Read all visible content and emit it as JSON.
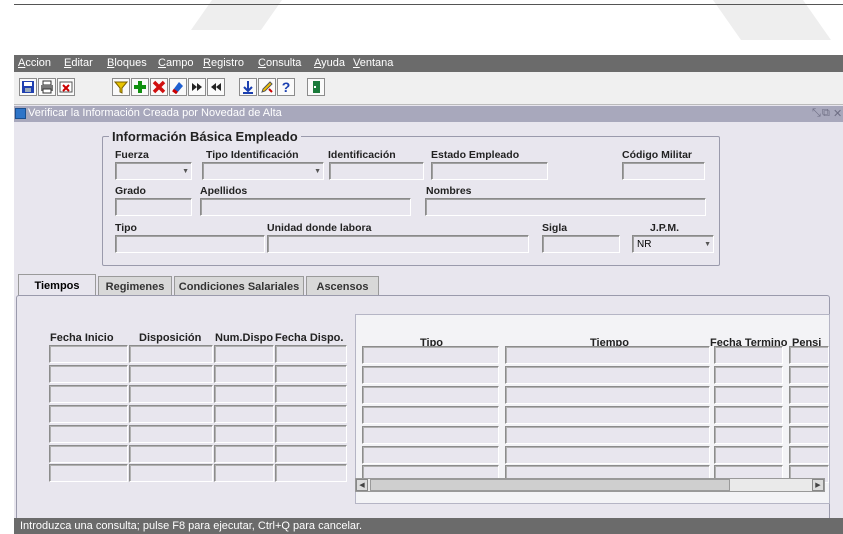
{
  "menu": [
    "Accion",
    "Editar",
    "Bloques",
    "Campo",
    "Registro",
    "Consulta",
    "Ayuda",
    "Ventana"
  ],
  "window": {
    "title": "Verificar la Información Creada por Novedad de Alta"
  },
  "group": {
    "title": "Información Básica Empleado",
    "labels": {
      "fuerza": "Fuerza",
      "tipo_identificacion": "Tipo Identificación",
      "identificacion": "Identificación",
      "estado_empleado": "Estado Empleado",
      "codigo_militar": "Código Militar",
      "grado": "Grado",
      "apellidos": "Apellidos",
      "nombres": "Nombres",
      "tipo": "Tipo",
      "unidad": "Unidad donde labora",
      "sigla": "Sigla",
      "jpm": "J.P.M."
    },
    "jpm_value": "NR"
  },
  "tabs": [
    "Tiempos",
    "Regimenes",
    "Condiciones Salariales",
    "Ascensos"
  ],
  "left_columns": [
    "Fecha Inicio",
    "Disposición",
    "Num.Dispo",
    "Fecha Dispo."
  ],
  "right_columns": [
    "Tipo",
    "Tiempo",
    "Fecha Termino",
    "Pensi"
  ],
  "status": "Introduzca una consulta;  pulse F8 para ejecutar, Ctrl+Q para cancelar."
}
